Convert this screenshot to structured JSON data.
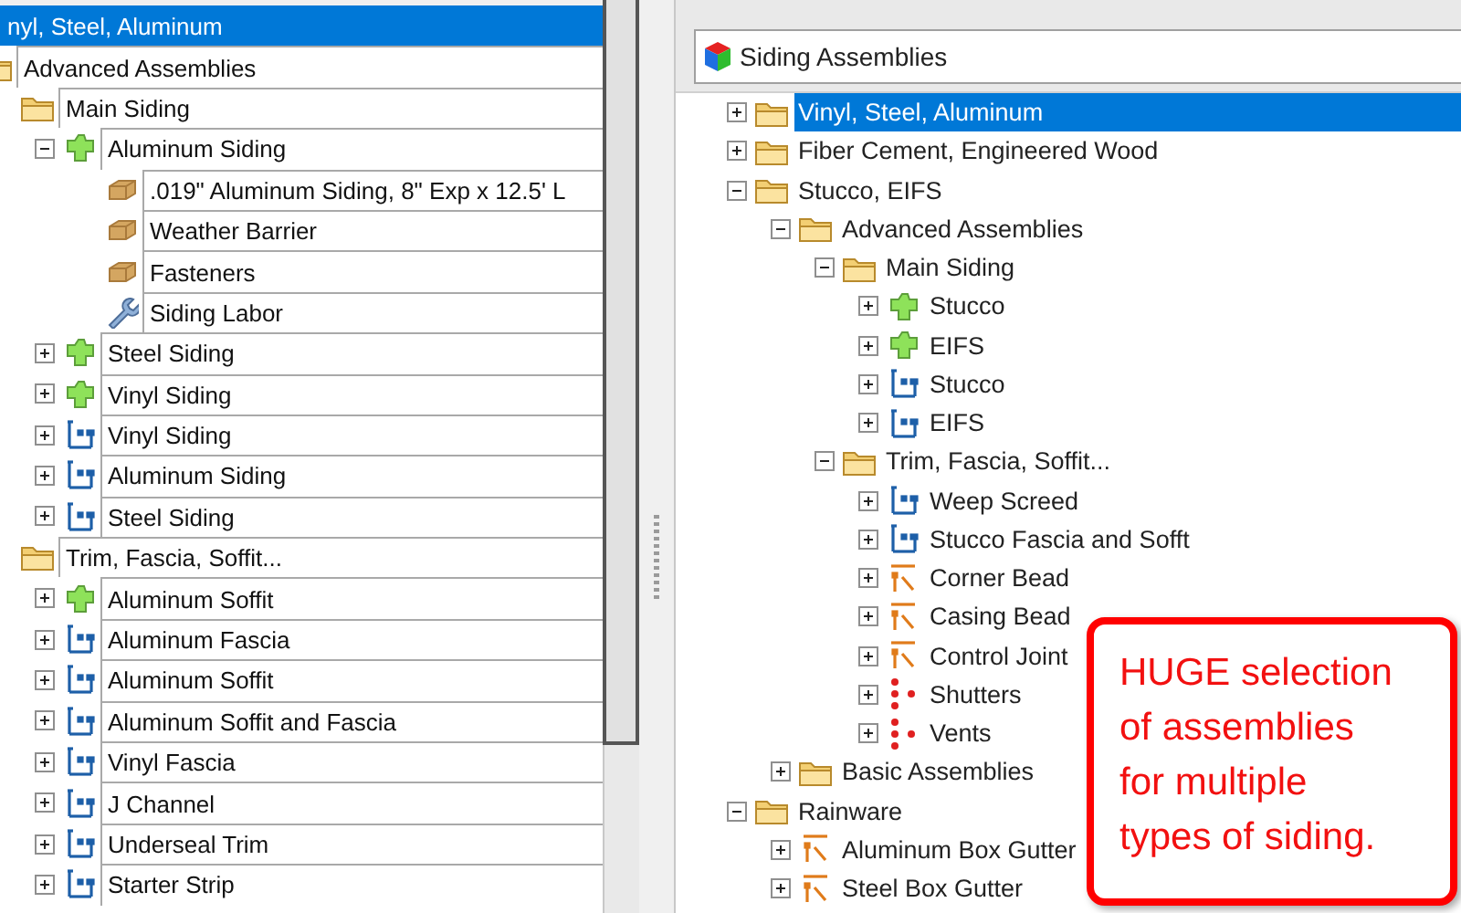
{
  "left_tree": {
    "items": [
      {
        "label": "nyl, Steel, Aluminum",
        "selected": true,
        "children": [
          {
            "label": "Advanced Assemblies",
            "kind": "folder",
            "selected": false,
            "children": [
              {
                "label": "Main Siding",
                "kind": "folder",
                "selected": false,
                "children": [
                  {
                    "label": "Aluminum Siding",
                    "kind": "assembly",
                    "expanded": true,
                    "selected": false,
                    "children": [
                      {
                        "label": ".019\" Aluminum Siding, 8\" Exp x 12.5' L",
                        "kind": "material",
                        "selected": false
                      },
                      {
                        "label": "Weather Barrier",
                        "kind": "material",
                        "selected": false
                      },
                      {
                        "label": "Fasteners",
                        "kind": "material",
                        "selected": false
                      },
                      {
                        "label": "Siding Labor",
                        "kind": "labor",
                        "selected": false
                      }
                    ]
                  },
                  {
                    "label": "Steel Siding",
                    "kind": "assembly",
                    "expanded": false,
                    "selected": false
                  },
                  {
                    "label": "Vinyl Siding",
                    "kind": "assembly",
                    "expanded": false,
                    "selected": false
                  },
                  {
                    "label": "Vinyl Siding",
                    "kind": "part",
                    "expanded": false,
                    "selected": false
                  },
                  {
                    "label": "Aluminum Siding",
                    "kind": "part",
                    "expanded": false,
                    "selected": false
                  },
                  {
                    "label": "Steel Siding",
                    "kind": "part",
                    "expanded": false,
                    "selected": false
                  }
                ]
              },
              {
                "label": "Trim, Fascia, Soffit...",
                "kind": "folder",
                "selected": false,
                "children": [
                  {
                    "label": "Aluminum Soffit",
                    "kind": "assembly",
                    "expanded": false,
                    "selected": false
                  },
                  {
                    "label": "Aluminum Fascia",
                    "kind": "part",
                    "expanded": false,
                    "selected": false
                  },
                  {
                    "label": "Aluminum Soffit",
                    "kind": "part",
                    "expanded": false,
                    "selected": false
                  },
                  {
                    "label": "Aluminum Soffit and Fascia",
                    "kind": "part",
                    "expanded": false,
                    "selected": false
                  },
                  {
                    "label": "Vinyl Fascia",
                    "kind": "part",
                    "expanded": false,
                    "selected": false
                  },
                  {
                    "label": "J Channel",
                    "kind": "part",
                    "expanded": false,
                    "selected": false
                  },
                  {
                    "label": "Underseal Trim",
                    "kind": "part",
                    "expanded": false,
                    "selected": false
                  },
                  {
                    "label": "Starter Strip",
                    "kind": "part",
                    "expanded": false,
                    "selected": false
                  }
                ]
              }
            ]
          }
        ]
      }
    ]
  },
  "right_panel": {
    "dropdown": {
      "value": "Siding Assemblies"
    },
    "tree": {
      "items": [
        {
          "label": "Vinyl, Steel, Aluminum",
          "kind": "folder",
          "expanded": false,
          "selected": true
        },
        {
          "label": "Fiber Cement, Engineered Wood",
          "kind": "folder",
          "expanded": false,
          "selected": false
        },
        {
          "label": "Stucco, EIFS",
          "kind": "folder",
          "expanded": true,
          "selected": false,
          "children": [
            {
              "label": "Advanced Assemblies",
              "kind": "folder",
              "expanded": true,
              "selected": false,
              "children": [
                {
                  "label": "Main Siding",
                  "kind": "folder",
                  "expanded": true,
                  "selected": false,
                  "children": [
                    {
                      "label": "Stucco",
                      "kind": "assembly",
                      "expanded": false,
                      "selected": false
                    },
                    {
                      "label": "EIFS",
                      "kind": "assembly",
                      "expanded": false,
                      "selected": false
                    },
                    {
                      "label": "Stucco",
                      "kind": "part",
                      "expanded": false,
                      "selected": false
                    },
                    {
                      "label": "EIFS",
                      "kind": "part",
                      "expanded": false,
                      "selected": false
                    }
                  ]
                },
                {
                  "label": "Trim, Fascia, Soffit...",
                  "kind": "folder",
                  "expanded": true,
                  "selected": false,
                  "children": [
                    {
                      "label": "Weep Screed",
                      "kind": "part",
                      "expanded": false,
                      "selected": false
                    },
                    {
                      "label": "Stucco Fascia and Sofft",
                      "kind": "part",
                      "expanded": false,
                      "selected": false
                    },
                    {
                      "label": "Corner Bead",
                      "kind": "trim",
                      "expanded": false,
                      "selected": false
                    },
                    {
                      "label": "Casing Bead",
                      "kind": "trim",
                      "expanded": false,
                      "selected": false
                    },
                    {
                      "label": "Control Joint",
                      "kind": "trim",
                      "expanded": false,
                      "selected": false
                    },
                    {
                      "label": "Shutters",
                      "kind": "dots",
                      "expanded": false,
                      "selected": false
                    },
                    {
                      "label": "Vents",
                      "kind": "dots",
                      "expanded": false,
                      "selected": false
                    }
                  ]
                }
              ]
            },
            {
              "label": "Basic Assemblies",
              "kind": "folder",
              "expanded": false,
              "selected": false
            }
          ]
        },
        {
          "label": "Rainware",
          "kind": "folder",
          "expanded": true,
          "selected": false,
          "children": [
            {
              "label": "Aluminum Box Gutter",
              "kind": "trim",
              "expanded": false,
              "selected": false
            },
            {
              "label": "Steel Box Gutter",
              "kind": "trim",
              "expanded": false,
              "selected": false
            }
          ]
        }
      ]
    }
  },
  "callout": {
    "text": "HUGE selection of assemblies for multiple types of siding."
  }
}
